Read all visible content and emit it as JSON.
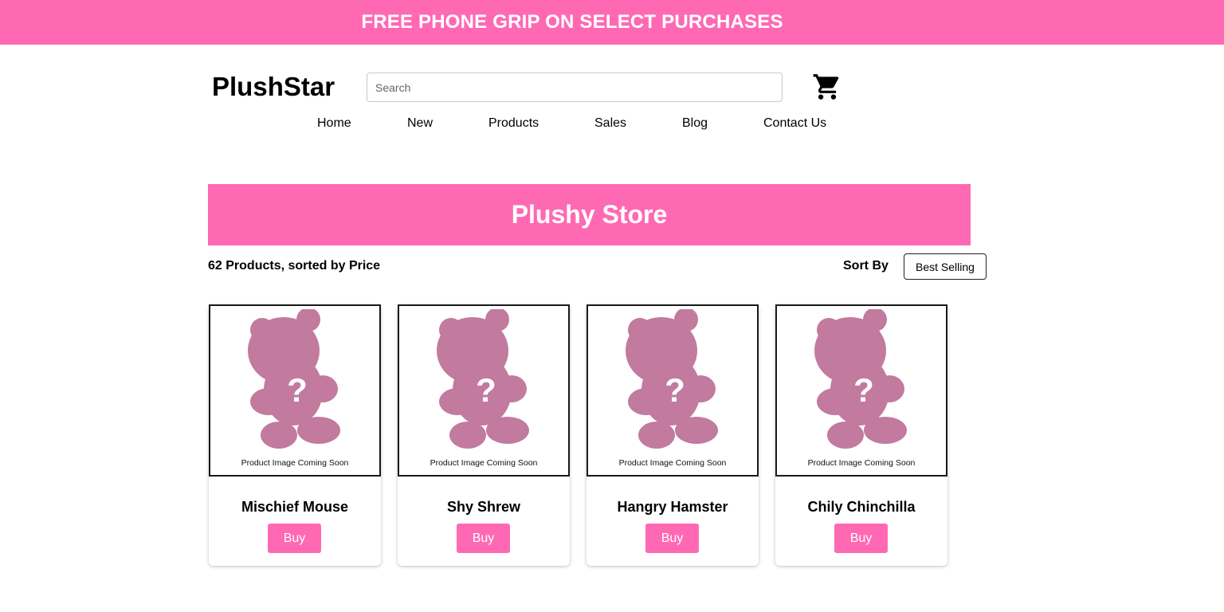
{
  "promo": {
    "text": "FREE PHONE GRIP ON SELECT PURCHASES"
  },
  "header": {
    "logo": "PlushStar",
    "search_placeholder": "Search",
    "cart_icon": "shopping-cart-icon"
  },
  "nav": {
    "items": [
      {
        "label": "Home"
      },
      {
        "label": "New"
      },
      {
        "label": "Products"
      },
      {
        "label": "Sales"
      },
      {
        "label": "Blog"
      },
      {
        "label": "Contact Us"
      }
    ]
  },
  "hero": {
    "title": "Plushy Store"
  },
  "listing": {
    "count_text": "62 Products, sorted by Price",
    "sort_label": "Sort By",
    "sort_value": "Best Selling"
  },
  "colors": {
    "accent": "#ff69b4",
    "placeholder_bear": "#c27a9e"
  },
  "products": [
    {
      "name": "Mischief Mouse",
      "image_caption": "Product Image Coming Soon",
      "buy_label": "Buy"
    },
    {
      "name": "Shy Shrew",
      "image_caption": "Product Image Coming Soon",
      "buy_label": "Buy"
    },
    {
      "name": "Hangry Hamster",
      "image_caption": "Product Image Coming Soon",
      "buy_label": "Buy"
    },
    {
      "name": "Chily Chinchilla",
      "image_caption": "Product Image Coming Soon",
      "buy_label": "Buy"
    }
  ]
}
